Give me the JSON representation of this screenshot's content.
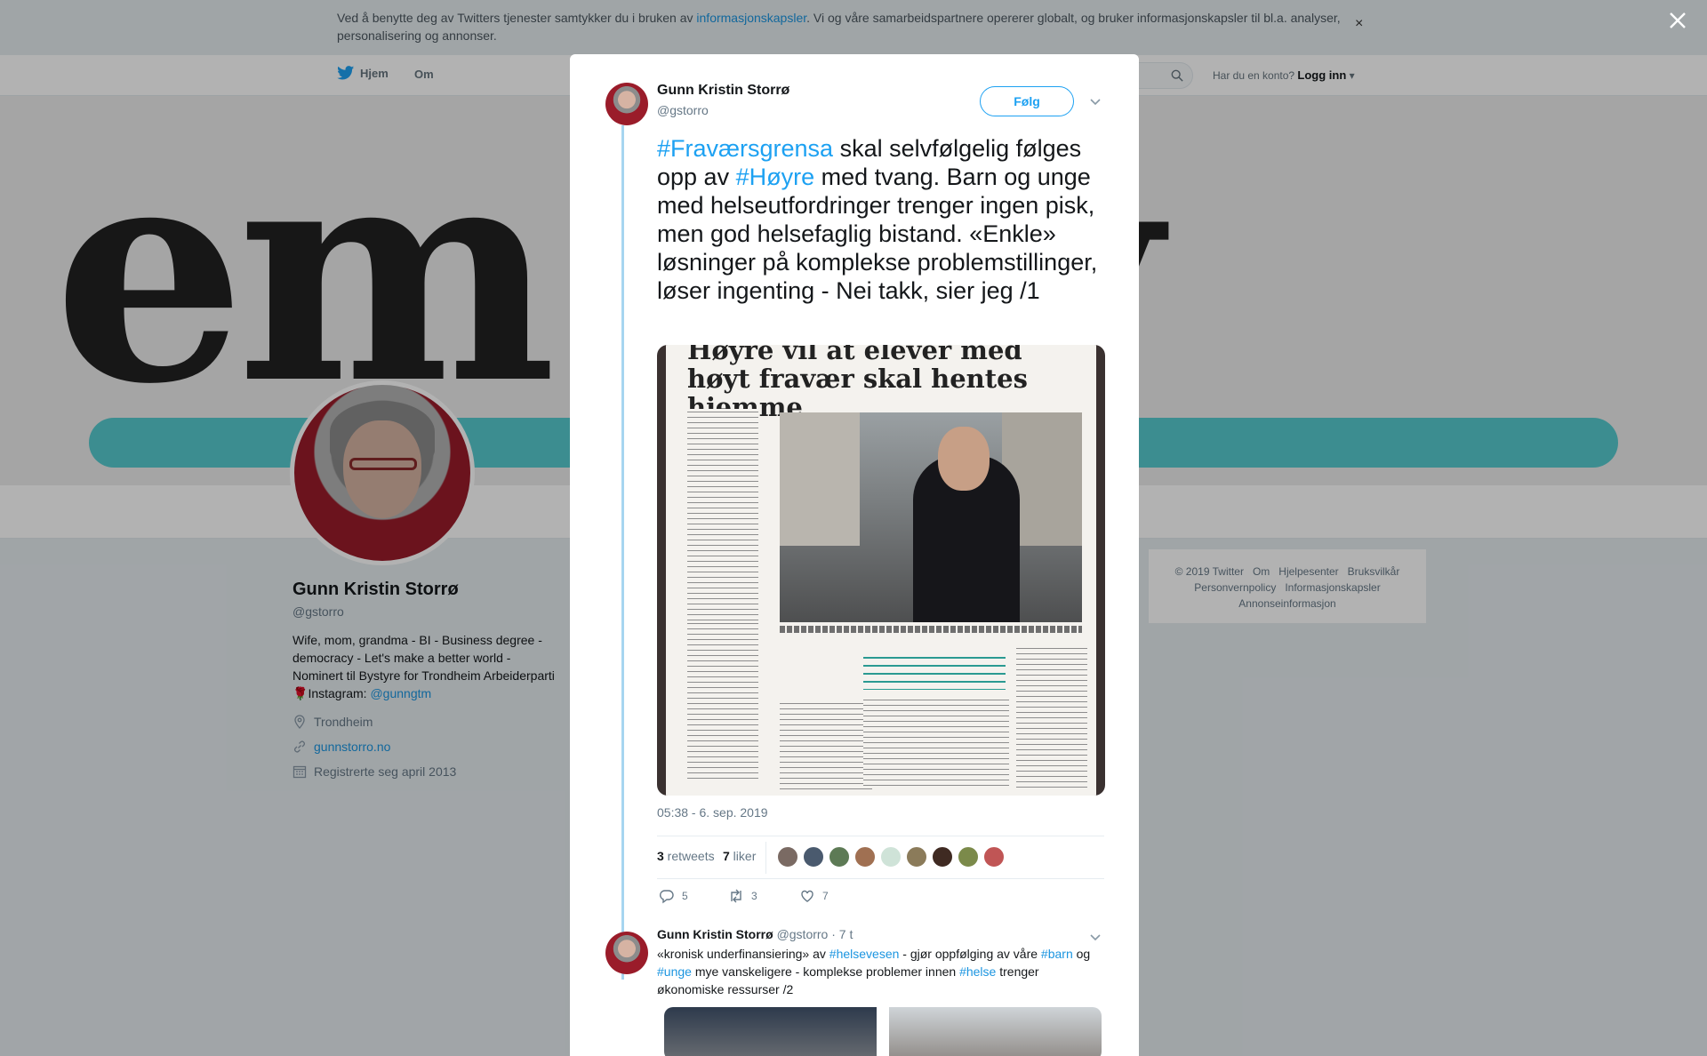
{
  "cookie": {
    "text_before": "Ved å benytte deg av Twitters tjenester samtykker du i bruken av ",
    "link": "informasjonskapsler",
    "text_after": ". Vi og våre samarbeidspartnere opererer globalt, og bruker informasjonskapsler til bl.a. analyser, personalisering og annonser.",
    "close": "×"
  },
  "nav": {
    "home": "Hjem",
    "about": "Om",
    "account_prompt": "Har du en konto?",
    "login": "Logg inn"
  },
  "profile": {
    "name": "Gunn Kristin Storrø",
    "handle": "@gstorro",
    "bio": "Wife, mom, grandma - BI - Business degree - democracy - Let's make a better world - Nominert til Bystyre for Trondheim Arbeiderparti",
    "bio_rose": "🌹",
    "bio_instagram": "Instagram: ",
    "bio_instagram_link": "@gunngtm",
    "location": "Trondheim",
    "website": "gunnstorro.no",
    "joined": "Registrerte seg april 2013"
  },
  "footer": {
    "links": [
      "© 2019 Twitter",
      "Om",
      "Hjelpesenter",
      "Bruksvilkår"
    ],
    "links2": [
      "Personvernpolicy",
      "Informasjonskapsler"
    ],
    "links3": [
      "Annonseinformasjon"
    ]
  },
  "modal": {
    "author_name": "Gunn Kristin Storrø",
    "author_handle": "@gstorro",
    "follow": "Følg",
    "tweet": {
      "tag1": "#Fraværsgrensa",
      "text1": " skal selvfølgelig følges opp av ",
      "tag2": "#Høyre",
      "text2": " med tvang. Barn og unge med helseutfordringer trenger ingen pisk, men god helsefaglig bistand. «Enkle» løsninger på komplekse problemstillinger, løser ingenting - Nei takk, sier jeg /1"
    },
    "image_headline": "Høyre vil at elever med høyt fravær skal hentes hjemme",
    "timestamp": "05:38 - 6. sep. 2019",
    "retweets_count": "3",
    "retweets_label": " retweets",
    "likes_count": "7",
    "likes_label": " liker",
    "reply_count": "5",
    "retweet_count": "3",
    "like_count": "7",
    "liker_colors": [
      "#7a6a63",
      "#4a5a6e",
      "#5d7a55",
      "#a07052",
      "#cfe3d8",
      "#8b7b5a",
      "#3f2a22",
      "#7b8a4a",
      "#c05555"
    ]
  },
  "reply": {
    "name": "Gunn Kristin Storrø",
    "handle": "@gstorro",
    "time": "· 7 t",
    "t1": "«kronisk underfinansiering» av ",
    "tag1": "#helsevesen",
    "t2": " - gjør oppfølging av våre ",
    "tag2": "#barn",
    "t3": " og ",
    "tag3": "#unge",
    "t4": " mye vanskeligere - komplekse problemer innen ",
    "tag4": "#helse",
    "t5": " trenger økonomiske ressurser /2"
  }
}
